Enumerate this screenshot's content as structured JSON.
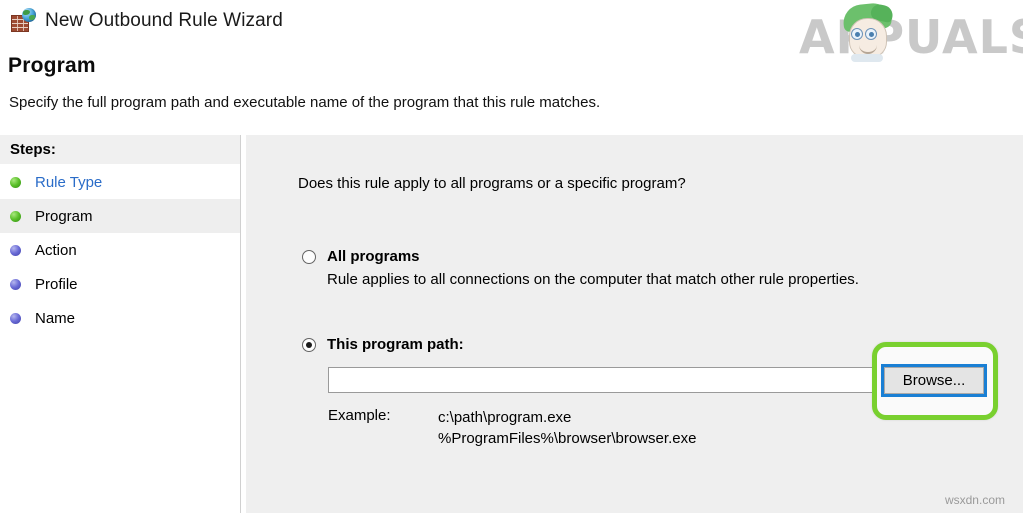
{
  "window": {
    "title": "New Outbound Rule Wizard",
    "icon": "firewall-brickwall-globe-icon"
  },
  "header": {
    "page_title": "Program",
    "page_subtitle": "Specify the full program path and executable name of the program that this rule matches."
  },
  "branding": {
    "logo_text": "APPUALS",
    "logo_color": "#c9c9c9",
    "watermark": "wsxdn.com"
  },
  "sidebar": {
    "header": "Steps:",
    "items": [
      {
        "label": "Rule Type",
        "bullet": "green",
        "state": "completed-link"
      },
      {
        "label": "Program",
        "bullet": "green",
        "state": "current"
      },
      {
        "label": "Action",
        "bullet": "blue",
        "state": "pending"
      },
      {
        "label": "Profile",
        "bullet": "blue",
        "state": "pending"
      },
      {
        "label": "Name",
        "bullet": "blue",
        "state": "pending"
      }
    ]
  },
  "main": {
    "question": "Does this rule apply to all programs or a specific program?",
    "options": [
      {
        "id": "all-programs",
        "label": "All programs",
        "description": "Rule applies to all connections on the computer that match other rule properties.",
        "checked": false
      },
      {
        "id": "this-program-path",
        "label": "This program path:",
        "checked": true
      }
    ],
    "path_input": {
      "value": "",
      "placeholder": ""
    },
    "browse_button": {
      "label": "Browse...",
      "focus_border_color": "#1a7fd4",
      "highlight_color": "#79d02f"
    },
    "example": {
      "label": "Example:",
      "values": [
        "c:\\path\\program.exe",
        "%ProgramFiles%\\browser\\browser.exe"
      ]
    }
  },
  "colors": {
    "panel_bg": "#efefef",
    "sidebar_bg": "#ffffff",
    "step_current_bg": "#eeeeee",
    "steps_header_bg": "#f0f0f0",
    "link": "#2a6cc8",
    "bullet_green": "#5bc02a",
    "bullet_blue": "#6a6bd6"
  }
}
